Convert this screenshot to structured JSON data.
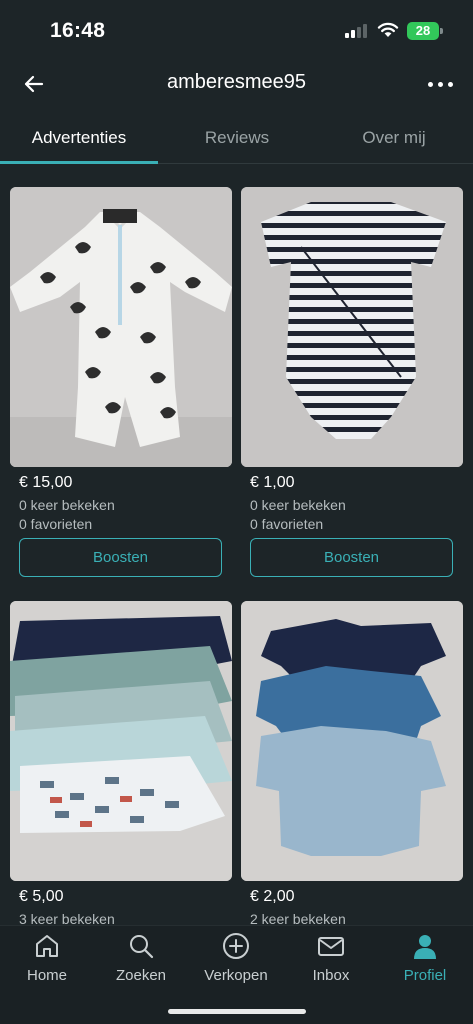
{
  "status_bar": {
    "time": "16:48",
    "battery": "28"
  },
  "header": {
    "title": "amberesmee95"
  },
  "tabs": [
    {
      "label": "Advertenties",
      "active": true
    },
    {
      "label": "Reviews",
      "active": false
    },
    {
      "label": "Over mij",
      "active": false
    }
  ],
  "listings": [
    {
      "price": "€ 15,00",
      "views": "0 keer bekeken",
      "favorites": "0 favorieten",
      "button": "Boosten",
      "photo": "white seahorse-print baby swimsuit"
    },
    {
      "price": "€ 1,00",
      "views": "0 keer bekeken",
      "favorites": "0 favorieten",
      "button": "Boosten",
      "photo": "navy striped baby bodysuit"
    },
    {
      "price": "€ 5,00",
      "views": "3 keer bekeken",
      "photo": "stack of long-sleeve baby shirts"
    },
    {
      "price": "€ 2,00",
      "views": "2 keer bekeken",
      "photo": "three blue baby bodysuits"
    }
  ],
  "bottom_nav": [
    {
      "label": "Home",
      "icon": "home-icon",
      "active": false
    },
    {
      "label": "Zoeken",
      "icon": "search-icon",
      "active": false
    },
    {
      "label": "Verkopen",
      "icon": "plus-circle-icon",
      "active": false
    },
    {
      "label": "Inbox",
      "icon": "mail-icon",
      "active": false
    },
    {
      "label": "Profiel",
      "icon": "profile-icon",
      "active": true
    }
  ],
  "colors": {
    "background": "#1d2528",
    "accent": "#3ab0b6",
    "battery": "#32c75a"
  }
}
